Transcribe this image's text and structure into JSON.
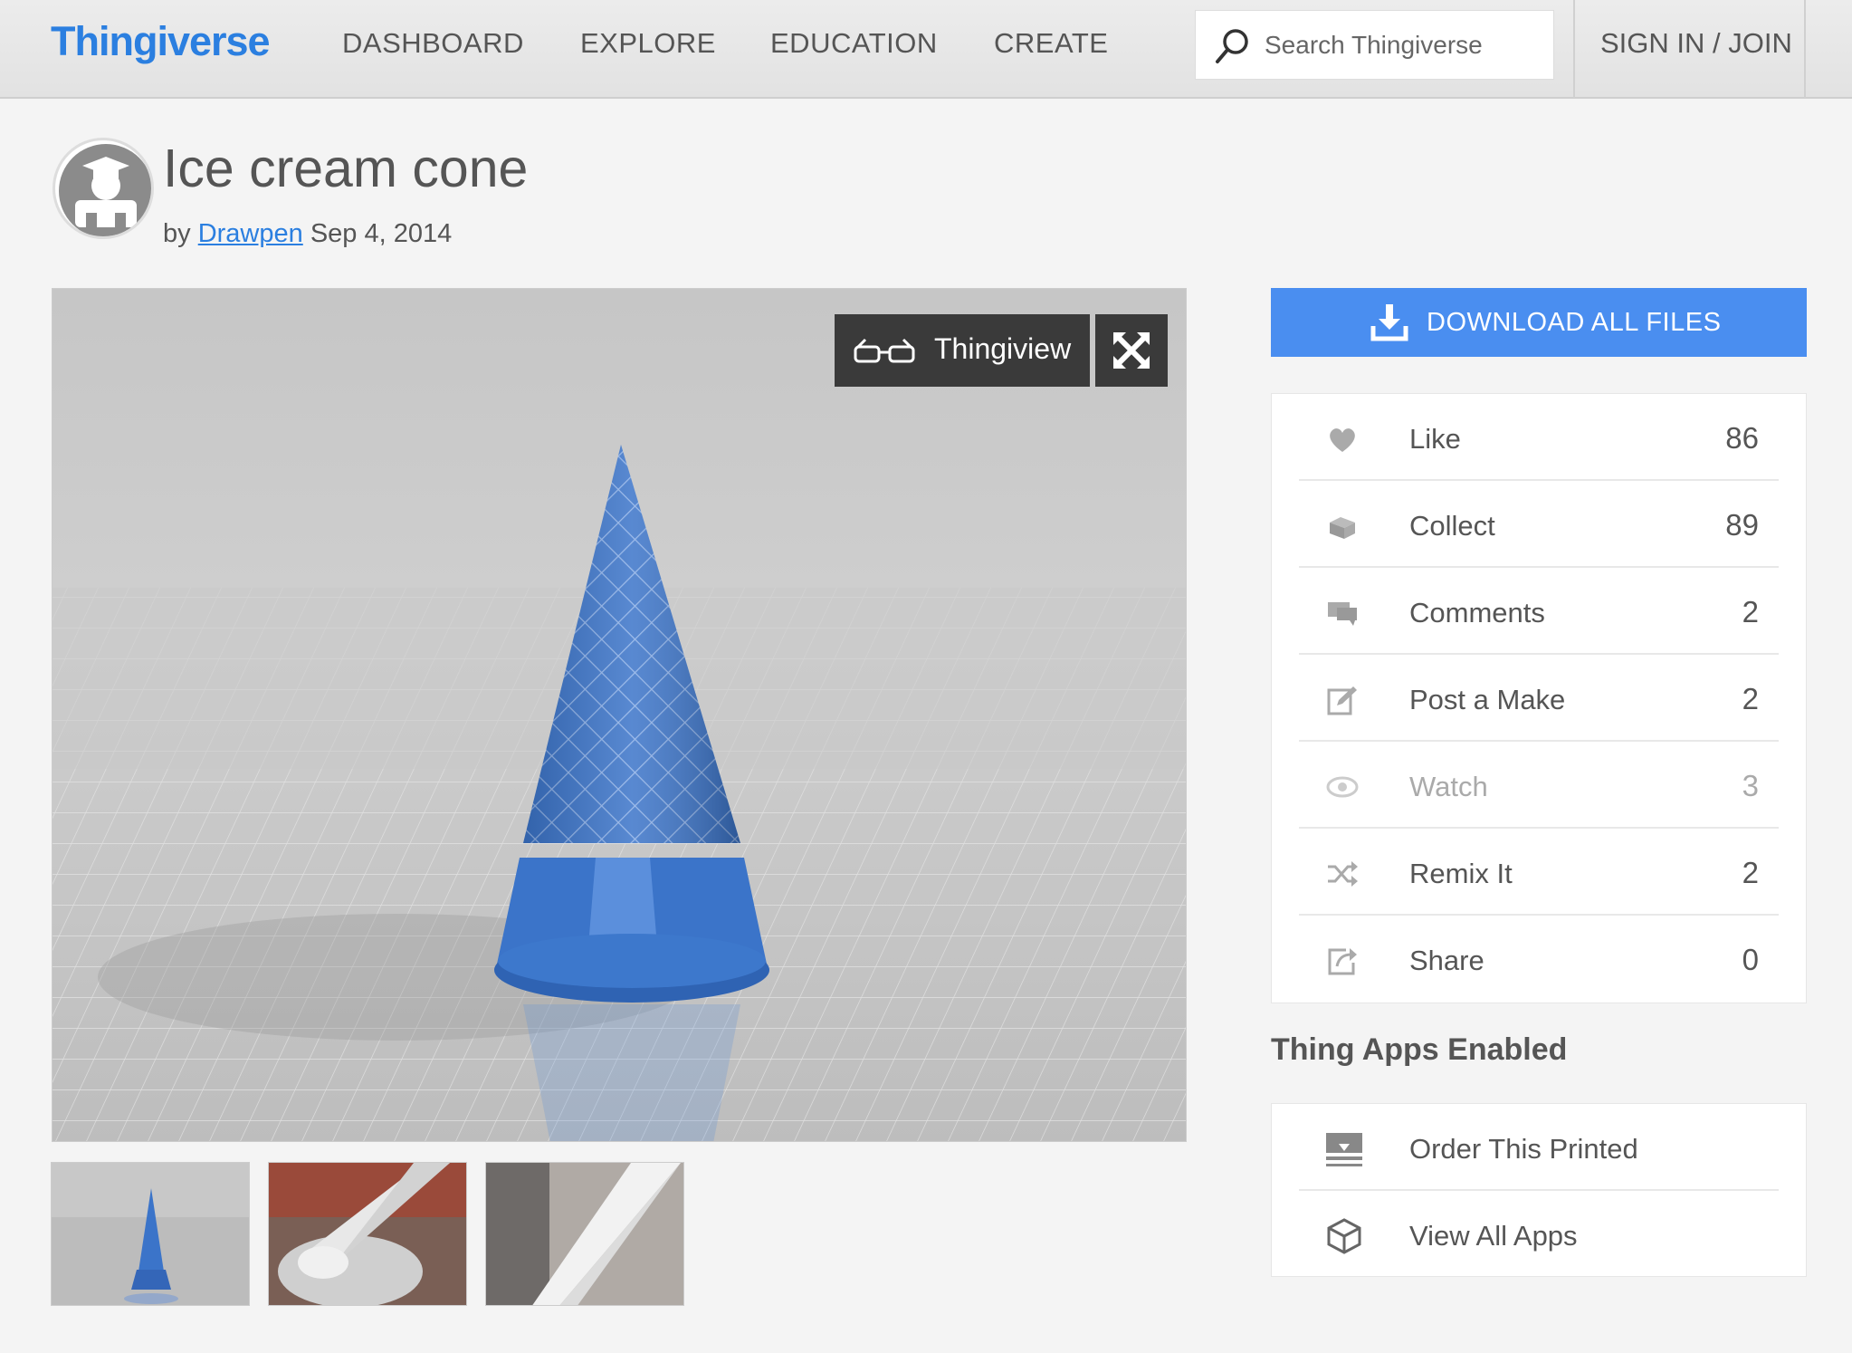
{
  "header": {
    "logo": "Thingiverse",
    "nav": [
      "DASHBOARD",
      "EXPLORE",
      "EDUCATION",
      "CREATE"
    ],
    "search_placeholder": "Search Thingiverse",
    "signin": "SIGN IN / JOIN"
  },
  "thing": {
    "title": "Ice cream cone",
    "by": "by",
    "author": "Drawpen",
    "date": "Sep 4, 2014"
  },
  "viewer": {
    "thingiview_label": "Thingiview",
    "model_color": "#3b74c9"
  },
  "actions": {
    "download_label": "DOWNLOAD ALL FILES",
    "stats": [
      {
        "label": "Like",
        "count": "86",
        "icon": "heart-icon"
      },
      {
        "label": "Collect",
        "count": "89",
        "icon": "collect-icon"
      },
      {
        "label": "Comments",
        "count": "2",
        "icon": "comment-icon"
      },
      {
        "label": "Post a Make",
        "count": "2",
        "icon": "edit-icon"
      },
      {
        "label": "Watch",
        "count": "3",
        "icon": "eye-icon"
      },
      {
        "label": "Remix It",
        "count": "2",
        "icon": "shuffle-icon"
      },
      {
        "label": "Share",
        "count": "0",
        "icon": "share-icon"
      }
    ]
  },
  "apps": {
    "heading": "Thing Apps Enabled",
    "items": [
      {
        "label": "Order This Printed",
        "icon": "printer-icon"
      },
      {
        "label": "View All Apps",
        "icon": "cube-icon"
      }
    ]
  },
  "colors": {
    "brand_blue": "#2b7fe0",
    "download_blue": "#4a8ef0"
  }
}
